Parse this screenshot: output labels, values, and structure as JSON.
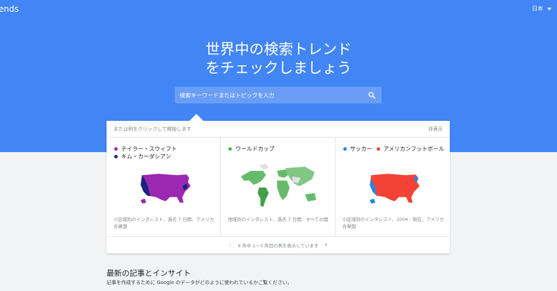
{
  "header": {
    "brand_partial": "ends",
    "language": "日本"
  },
  "hero": {
    "line1": "世界中の検索トレンド",
    "line2": "をチェックしましょう"
  },
  "search": {
    "placeholder": "検索キーワードまたはトピックを入力",
    "icon": "search-icon"
  },
  "examples": {
    "hint": "または例をクリックして開始します",
    "hide_label": "非表示",
    "cards": [
      {
        "legend": [
          {
            "label": "テイラー・スウィフト",
            "color": "#9c27b0"
          },
          {
            "label": "キム・カーダシアン",
            "color": "#1a237e"
          }
        ],
        "map": "us-map",
        "caption": "小区域別のインタレスト、過去 7 日間、アメリカ合衆国"
      },
      {
        "legend": [
          {
            "label": "ワールドカップ",
            "color": "#4caf50"
          }
        ],
        "map": "world-map",
        "caption": "地域別のインタレスト、過去 7 日間、すべての国"
      },
      {
        "legend": [
          {
            "label": "サッカー",
            "color": "#1e88e5"
          },
          {
            "label": "アメリカンフットボール",
            "color": "#f44336"
          }
        ],
        "map": "us-map",
        "caption": "小区域別のインタレスト、2004 - 現在、アメリカ合衆国"
      }
    ],
    "pager_text": "6 件中 1〜3 件目の例を表示しています"
  },
  "articles": {
    "title": "最新の記事とインサイト",
    "subtitle": "記事を作成するために Google のデータがどのように使われているかご覧ください。"
  }
}
